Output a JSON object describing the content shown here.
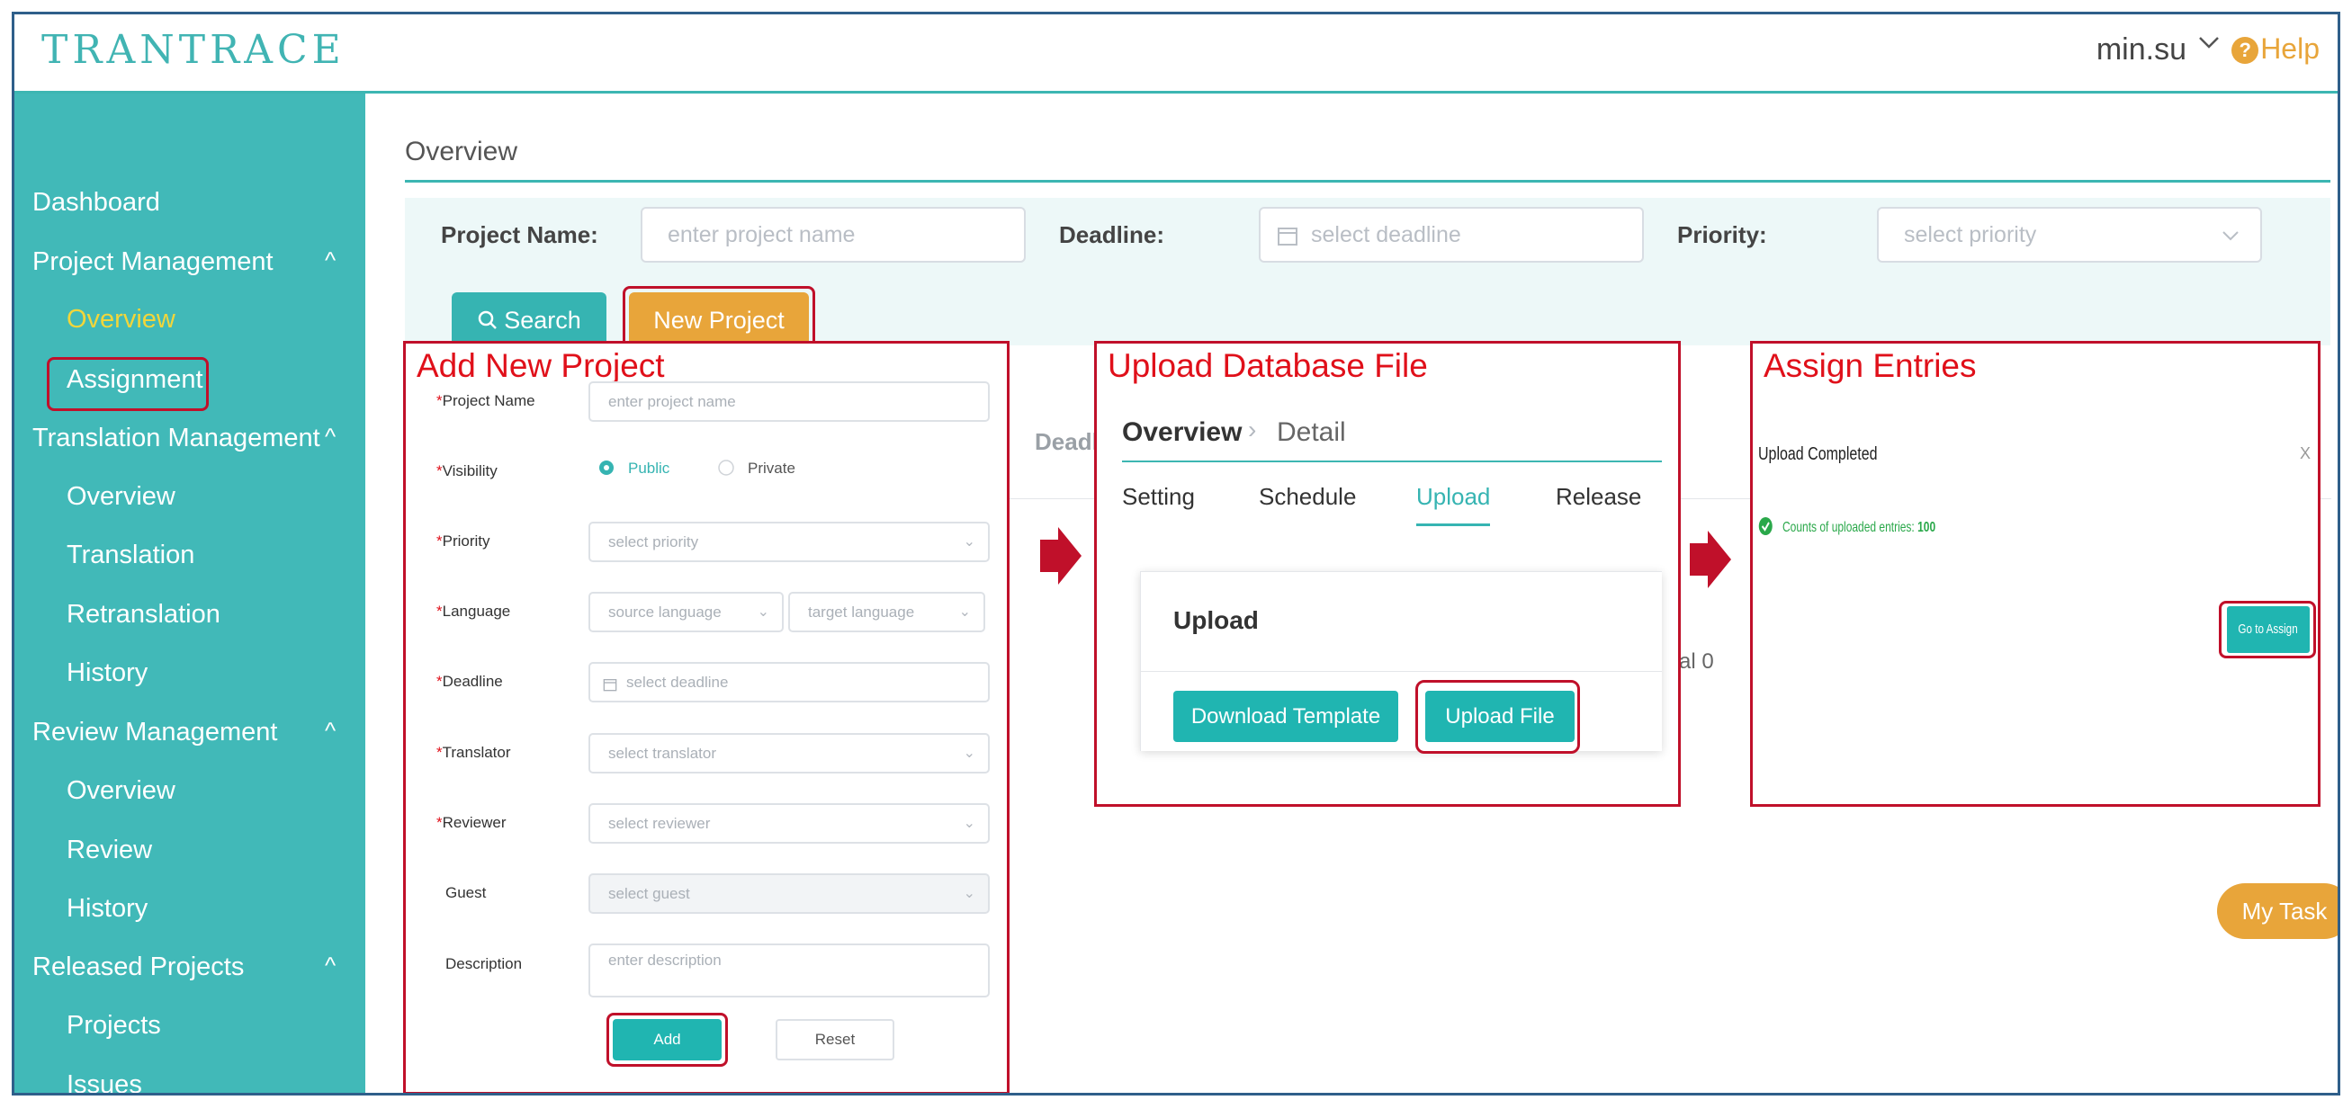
{
  "header": {
    "logo": "TRANTRACE",
    "user": "min.su",
    "help": "Help"
  },
  "sidebar": {
    "items": [
      {
        "label": "Dashboard"
      },
      {
        "label": "Project Management"
      },
      {
        "label": "Overview"
      },
      {
        "label": "Assignment"
      },
      {
        "label": "Translation Management"
      },
      {
        "label": "Overview"
      },
      {
        "label": "Translation"
      },
      {
        "label": "Retranslation"
      },
      {
        "label": "History"
      },
      {
        "label": "Review Management"
      },
      {
        "label": "Overview"
      },
      {
        "label": "Review"
      },
      {
        "label": "History"
      },
      {
        "label": "Released Projects"
      },
      {
        "label": "Projects"
      },
      {
        "label": "Issues"
      }
    ]
  },
  "main": {
    "breadcrumb": "Overview",
    "filter": {
      "project_name_label": "Project Name:",
      "project_name_placeholder": "enter project name",
      "deadline_label": "Deadline:",
      "deadline_placeholder": "select deadline",
      "priority_label": "Priority:",
      "priority_placeholder": "select priority",
      "search_label": "Search",
      "new_project_label": "New Project"
    },
    "background_text": {
      "deadline_partial": "Deadli",
      "total_partial": "al 0"
    },
    "my_task": "My Task"
  },
  "add_panel": {
    "title": "Add New Project",
    "project_name_label": "Project Name",
    "project_name_placeholder": "enter project name",
    "visibility_label": "Visibility",
    "public_label": "Public",
    "private_label": "Private",
    "priority_label": "Priority",
    "priority_placeholder": "select priority",
    "language_label": "Language",
    "source_placeholder": "source language",
    "target_placeholder": "target language",
    "deadline_label": "Deadline",
    "deadline_placeholder": "select deadline",
    "translator_label": "Translator",
    "translator_placeholder": "select translator",
    "reviewer_label": "Reviewer",
    "reviewer_placeholder": "select reviewer",
    "guest_label": "Guest",
    "guest_placeholder": "select guest",
    "description_label": "Description",
    "description_placeholder": "enter description",
    "add_label": "Add",
    "reset_label": "Reset"
  },
  "upload_panel": {
    "title": "Upload Database File",
    "crumb_overview": "Overview",
    "crumb_detail": "Detail",
    "tabs": [
      "Setting",
      "Schedule",
      "Upload",
      "Release"
    ],
    "card_title": "Upload",
    "download_label": "Download Template",
    "upload_label": "Upload File"
  },
  "assign_panel": {
    "title": "Assign Entries",
    "dialog_title": "Upload Completed",
    "close": "X",
    "counts_label": "Counts of uploaded entries:",
    "counts_value": "100",
    "go_label": "Go to Assign"
  },
  "colors": {
    "teal": "#41b9b8",
    "orange": "#e8a53a",
    "annotation_red": "#c0102a"
  }
}
